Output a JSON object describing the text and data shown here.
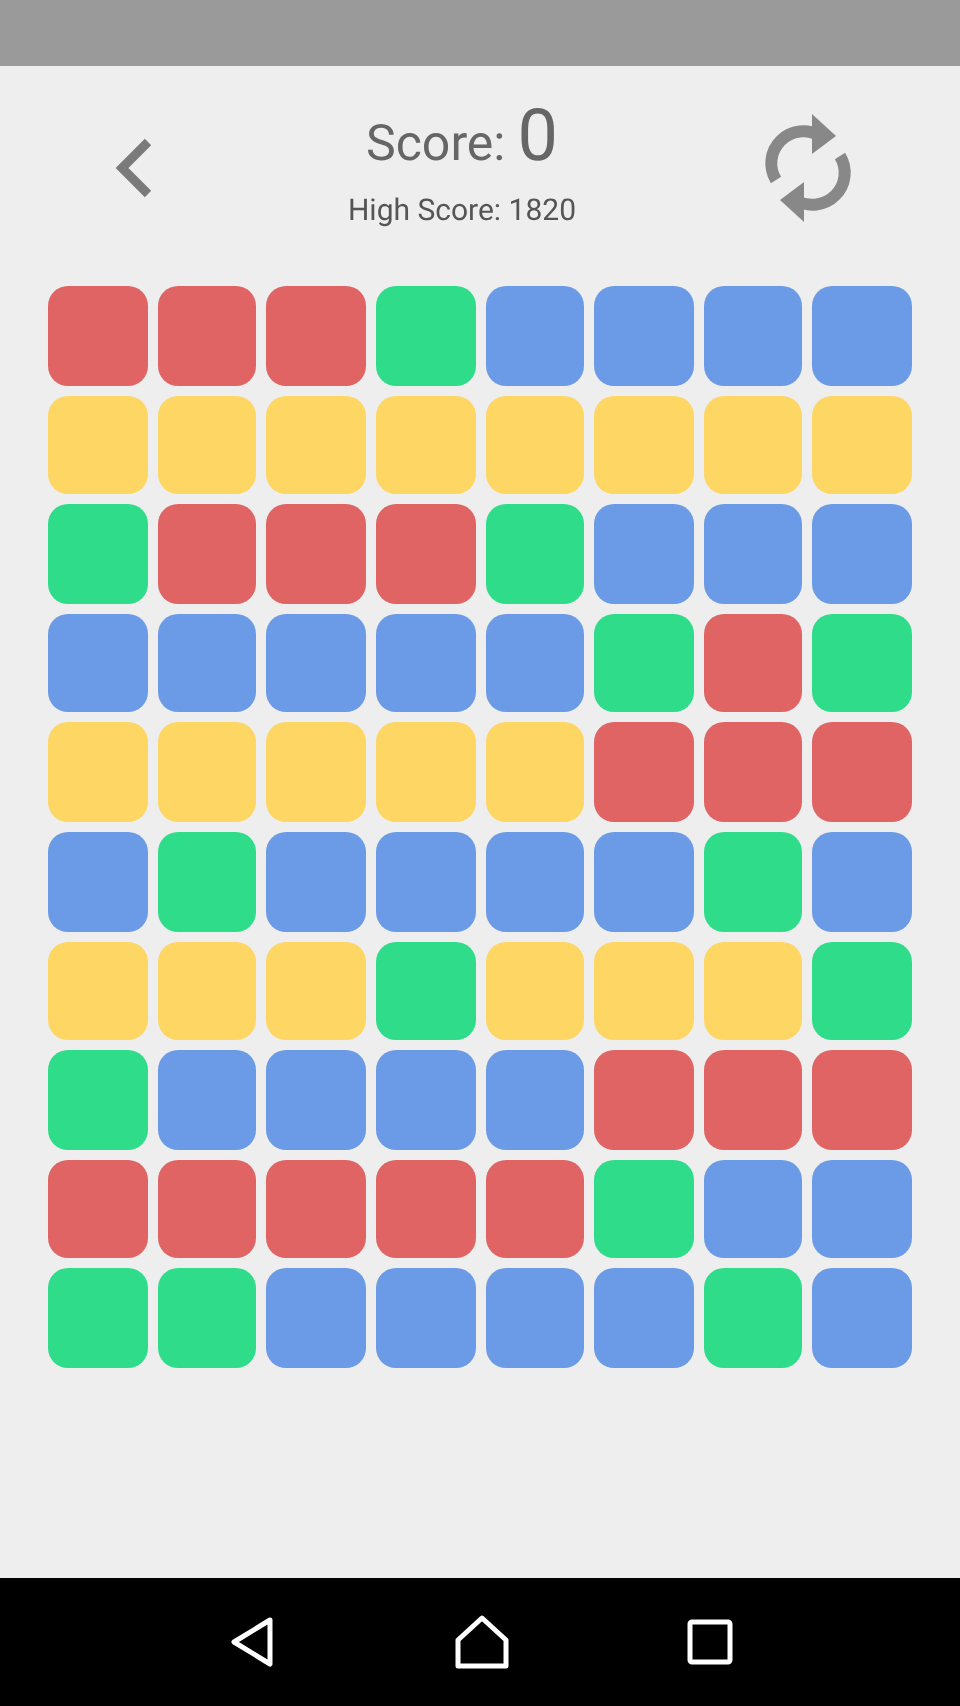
{
  "header": {
    "score_label": "Score:",
    "score_value": "0",
    "high_score": "High Score: 1820"
  },
  "board": {
    "rows": [
      {
        "tiles": [
          {
            "color": "#e06464"
          },
          {
            "color": "#e06464"
          },
          {
            "color": "#e06464"
          },
          {
            "color": "#2fdc89"
          },
          {
            "color": "#6b9be6"
          },
          {
            "color": "#6b9be6"
          },
          {
            "color": "#6b9be6"
          },
          {
            "color": "#6b9be6"
          }
        ]
      },
      {
        "tiles": [
          {
            "color": "#fdd663"
          },
          {
            "color": "#fdd663"
          },
          {
            "color": "#fdd663"
          },
          {
            "color": "#fdd663"
          },
          {
            "color": "#fdd663"
          },
          {
            "color": "#fdd663"
          },
          {
            "color": "#fdd663"
          },
          {
            "color": "#fdd663"
          }
        ]
      },
      {
        "tiles": [
          {
            "color": "#2fdc89"
          },
          {
            "color": "#e06464"
          },
          {
            "color": "#e06464"
          },
          {
            "color": "#e06464"
          },
          {
            "color": "#2fdc89"
          },
          {
            "color": "#6b9be6"
          },
          {
            "color": "#6b9be6"
          },
          {
            "color": "#6b9be6"
          }
        ]
      },
      {
        "tiles": [
          {
            "color": "#6b9be6"
          },
          {
            "color": "#6b9be6"
          },
          {
            "color": "#6b9be6"
          },
          {
            "color": "#6b9be6"
          },
          {
            "color": "#6b9be6"
          },
          {
            "color": "#2fdc89"
          },
          {
            "color": "#e06464"
          },
          {
            "color": "#2fdc89"
          }
        ]
      },
      {
        "tiles": [
          {
            "color": "#fdd663"
          },
          {
            "color": "#fdd663"
          },
          {
            "color": "#fdd663"
          },
          {
            "color": "#fdd663"
          },
          {
            "color": "#fdd663"
          },
          {
            "color": "#e06464"
          },
          {
            "color": "#e06464"
          },
          {
            "color": "#e06464"
          }
        ]
      },
      {
        "tiles": [
          {
            "color": "#6b9be6"
          },
          {
            "color": "#2fdc89"
          },
          {
            "color": "#6b9be6"
          },
          {
            "color": "#6b9be6"
          },
          {
            "color": "#6b9be6"
          },
          {
            "color": "#6b9be6"
          },
          {
            "color": "#2fdc89"
          },
          {
            "color": "#6b9be6"
          }
        ]
      },
      {
        "tiles": [
          {
            "color": "#fdd663"
          },
          {
            "color": "#fdd663"
          },
          {
            "color": "#fdd663"
          },
          {
            "color": "#2fdc89"
          },
          {
            "color": "#fdd663"
          },
          {
            "color": "#fdd663"
          },
          {
            "color": "#fdd663"
          },
          {
            "color": "#2fdc89"
          }
        ]
      },
      {
        "tiles": [
          {
            "color": "#2fdc89"
          },
          {
            "color": "#6b9be6"
          },
          {
            "color": "#6b9be6"
          },
          {
            "color": "#6b9be6"
          },
          {
            "color": "#6b9be6"
          },
          {
            "color": "#e06464"
          },
          {
            "color": "#e06464"
          },
          {
            "color": "#e06464"
          }
        ]
      },
      {
        "tiles": [
          {
            "color": "#e06464"
          },
          {
            "color": "#e06464"
          },
          {
            "color": "#e06464"
          },
          {
            "color": "#e06464"
          },
          {
            "color": "#e06464"
          },
          {
            "color": "#2fdc89"
          },
          {
            "color": "#6b9be6"
          },
          {
            "color": "#6b9be6"
          }
        ]
      },
      {
        "tiles": [
          {
            "color": "#2fdc89"
          },
          {
            "color": "#2fdc89"
          },
          {
            "color": "#6b9be6"
          },
          {
            "color": "#6b9be6"
          },
          {
            "color": "#6b9be6"
          },
          {
            "color": "#6b9be6"
          },
          {
            "color": "#2fdc89"
          },
          {
            "color": "#6b9be6"
          }
        ]
      }
    ]
  }
}
